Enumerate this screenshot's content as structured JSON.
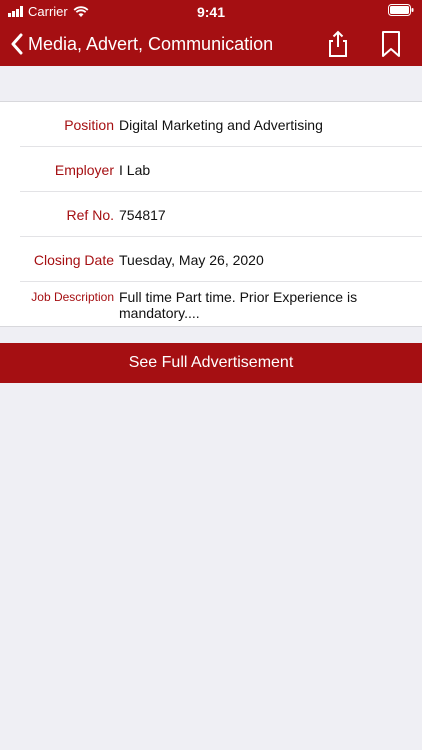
{
  "status_bar": {
    "carrier": "Carrier",
    "time": "9:41"
  },
  "nav": {
    "title": "Media, Advert, Communication"
  },
  "details": {
    "position_label": "Position",
    "position_value": "Digital Marketing and Advertising",
    "employer_label": "Employer",
    "employer_value": "I Lab",
    "ref_label": "Ref No.",
    "ref_value": "754817",
    "closing_label": "Closing Date",
    "closing_value": "Tuesday, May 26, 2020",
    "desc_label": "Job Description",
    "desc_value": "Full time   Part time. Prior Experience is mandatory...."
  },
  "actions": {
    "full_ad_label": "See Full Advertisement"
  },
  "colors": {
    "brand": "#a50f12",
    "background": "#efeff4"
  },
  "icons": [
    "back-chevron-icon",
    "share-icon",
    "bookmark-icon",
    "wifi-icon",
    "signal-icon",
    "battery-icon"
  ]
}
